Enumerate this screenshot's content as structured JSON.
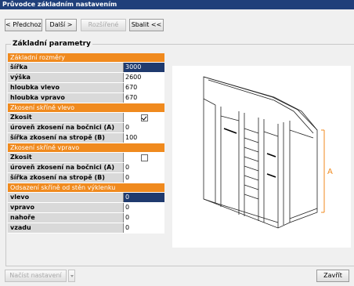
{
  "window": {
    "title": "Průvodce základním nastavením"
  },
  "toolbar": {
    "prev_label": "< Předchozí",
    "next_label": "Další >",
    "advanced_label": "Rozšířené",
    "collapse_label": "Sbalit <<"
  },
  "group": {
    "title": "Základní parametry"
  },
  "sections": {
    "s1": {
      "title": "Základní rozměry",
      "rows": [
        {
          "label": "šířka",
          "value": "3000"
        },
        {
          "label": "výška",
          "value": "2600"
        },
        {
          "label": "hloubka vlevo",
          "value": "670"
        },
        {
          "label": "hloubka vpravo",
          "value": "670"
        }
      ]
    },
    "s2": {
      "title": "Zkosení skříně vlevo",
      "rows": [
        {
          "label": "Zkosit",
          "checked": true
        },
        {
          "label": "úroveň zkosení na bočnici (A)",
          "value": "0"
        },
        {
          "label": "šířka zkosení na stropě (B)",
          "value": "100"
        }
      ]
    },
    "s3": {
      "title": "Zkosení skříně vpravo",
      "rows": [
        {
          "label": "Zkosit",
          "checked": false
        },
        {
          "label": "úroveň zkosení na bočnici (A)",
          "value": "0"
        },
        {
          "label": "šířka zkosení na stropě (B)",
          "value": "0"
        }
      ]
    },
    "s4": {
      "title": "Odsazení skříně od stěn výklenku",
      "rows": [
        {
          "label": "vlevo",
          "value": "0"
        },
        {
          "label": "vpravo",
          "value": "0"
        },
        {
          "label": "nahoře",
          "value": "0"
        },
        {
          "label": "vzadu",
          "value": "0"
        }
      ]
    }
  },
  "drawing": {
    "dimension_label": "A",
    "accent": "#f08a1e"
  },
  "footer": {
    "load_label": "Načíst nastavení",
    "close_label": "Zavřít"
  },
  "colors": {
    "title_bar": "#1f3f7a",
    "section_header": "#f08a1e",
    "selected_cell": "#1f3a6e"
  }
}
